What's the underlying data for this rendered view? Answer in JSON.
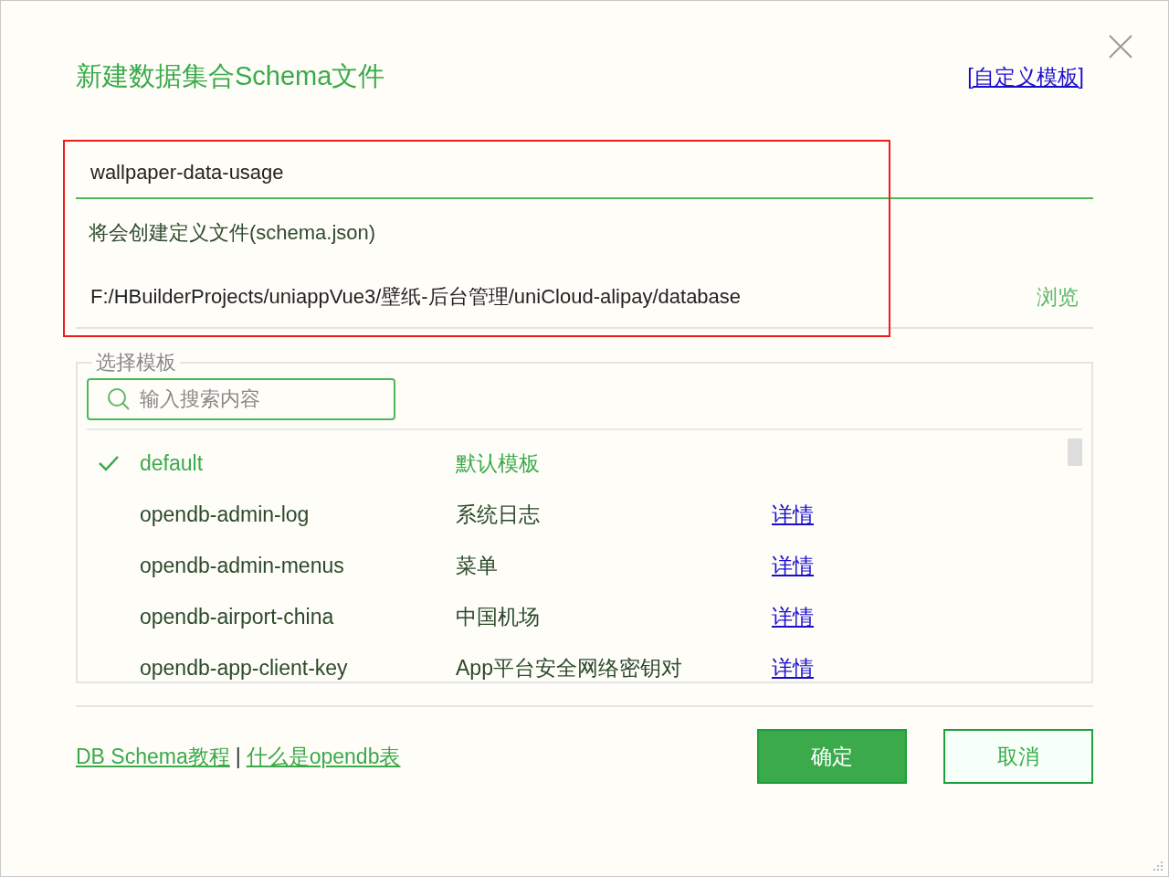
{
  "dialog": {
    "title": "新建数据集合Schema文件",
    "custom_template_link": "[自定义模板]",
    "name_value": "wallpaper-data-usage",
    "hint": "将会创建定义文件(schema.json)",
    "path": "F:/HBuilderProjects/uniappVue3/壁纸-后台管理/uniCloud-alipay/database",
    "browse": "浏览"
  },
  "template_group": {
    "legend": "选择模板",
    "search": {
      "placeholder": "输入搜索内容"
    },
    "rows": [
      {
        "name": "default",
        "description": "默认模板",
        "selected": true
      },
      {
        "name": "opendb-admin-log",
        "description": "系统日志",
        "link": "详情",
        "selected": false
      },
      {
        "name": "opendb-admin-menus",
        "description": "菜单",
        "link": "详情",
        "selected": false
      },
      {
        "name": "opendb-airport-china",
        "description": "中国机场",
        "link": "详情",
        "selected": false
      },
      {
        "name": "opendb-app-client-key",
        "description": "App平台安全网络密钥对",
        "link": "详情",
        "selected": false
      }
    ]
  },
  "footer": {
    "links": [
      "DB Schema教程",
      "什么是opendb表"
    ],
    "separator": "|",
    "buttons": [
      {
        "label": "确定",
        "kind": "primary"
      },
      {
        "label": "取消",
        "kind": "secondary"
      }
    ]
  }
}
